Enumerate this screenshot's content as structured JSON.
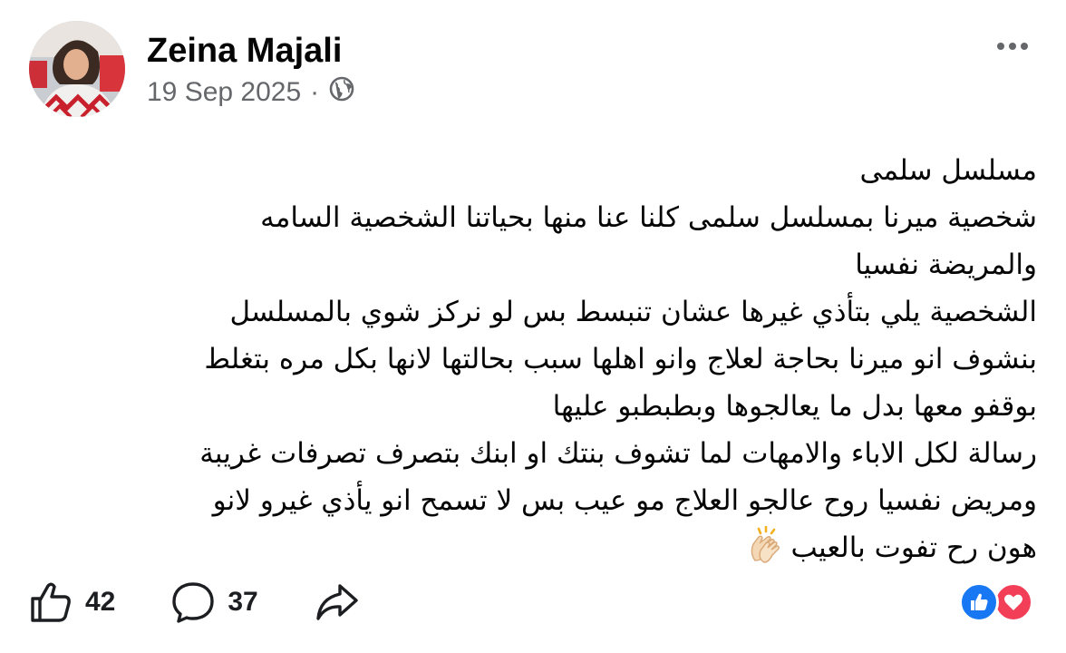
{
  "post": {
    "author": "Zeina Majali",
    "date": "19 Sep 2025",
    "separator": "·",
    "audience_icon": "globe-icon",
    "more_icon": "more-options-icon",
    "lines": [
      "مسلسل سلمى",
      "شخصية ميرنا بمسلسل سلمى كلنا عنا منها بحياتنا الشخصية السامه",
      "والمريضة نفسيا",
      "الشخصية يلي بتأذي غيرها عشان تنبسط بس لو نركز شوي بالمسلسل",
      "بنشوف انو ميرنا بحاجة لعلاج وانو اهلها سبب بحالتها لانها بكل مره بتغلط",
      "بوقفو معها بدل ما يعالجوها وبطبطبو عليها",
      "رسالة لكل الاباء والامهات لما تشوف بنتك او ابنك بتصرف تصرفات غريبة",
      "ومريض نفسيا روح عالجو العلاج مو عيب بس لا تسمح انو يأذي غيرو لانو",
      "هون رح تفوت بالعيب"
    ],
    "end_emoji_icon": "clapping-hands-icon"
  },
  "actions": {
    "like_count": "42",
    "comment_count": "37",
    "like_icon": "thumbs-up-icon",
    "comment_icon": "comment-bubble-icon",
    "share_icon": "share-arrow-icon"
  },
  "reactions": {
    "icons": [
      "like-reaction-icon",
      "love-reaction-icon"
    ],
    "colors": {
      "like": "#1877f2",
      "love": "#f33e58"
    }
  },
  "colors": {
    "text": "#050505",
    "secondary": "#65676b"
  }
}
